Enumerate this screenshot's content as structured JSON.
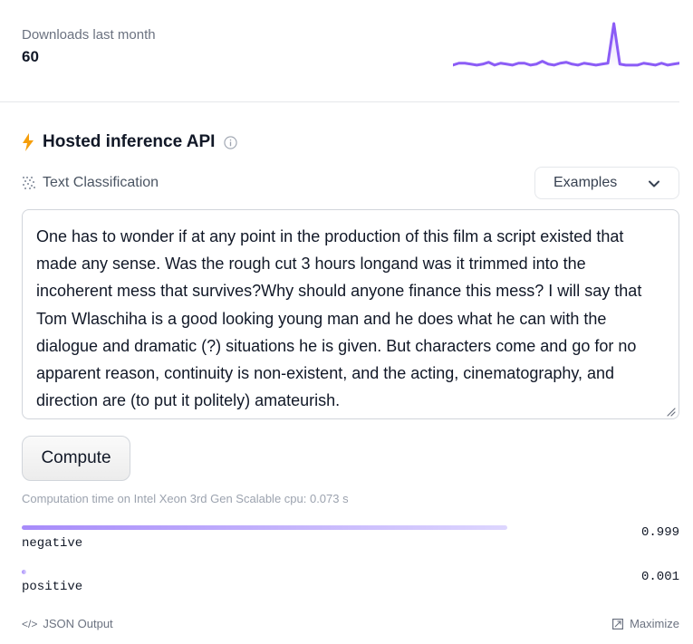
{
  "downloads": {
    "label": "Downloads last month",
    "count": "60",
    "sparkline_values": [
      4,
      6,
      6,
      5,
      4,
      5,
      7,
      4,
      6,
      5,
      4,
      6,
      6,
      4,
      5,
      8,
      5,
      4,
      6,
      7,
      5,
      4,
      6,
      5,
      4,
      5,
      6,
      48,
      5,
      4,
      4,
      4,
      6,
      5,
      4,
      6,
      4,
      5,
      6
    ],
    "accent_color": "#8b5cf6"
  },
  "api": {
    "title": "Hosted inference API",
    "icon_color": "#f59e0b"
  },
  "task": {
    "label": "Text Classification"
  },
  "examples": {
    "label": "Examples"
  },
  "input": {
    "value": "One has to wonder if at any point in the production of this film a script existed that made any sense. Was the rough cut 3 hours longand was it trimmed into the incoherent mess that survives?Why should anyone finance this mess? I will say that Tom Wlaschiha is a good looking young man and he does what he can with the dialogue and dramatic (?) situations he is given. But characters come and go for no apparent reason, continuity is non-existent, and the acting, cinematography, and direction are (to put it politely) amateurish."
  },
  "compute": {
    "label": "Compute"
  },
  "computation_time": "Computation time on Intel Xeon 3rd Gen Scalable cpu: 0.073 s",
  "results": [
    {
      "label": "negative",
      "score": "0.999",
      "fraction": 0.999
    },
    {
      "label": "positive",
      "score": "0.001",
      "fraction": 0.001
    }
  ],
  "footer": {
    "json_label": "JSON Output",
    "maximize_label": "Maximize"
  }
}
